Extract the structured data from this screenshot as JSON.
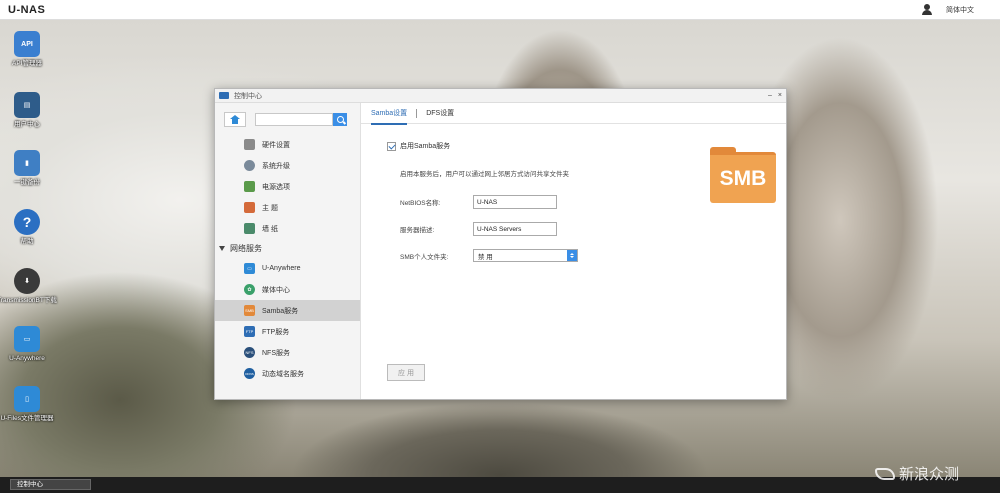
{
  "topbar": {
    "brand": "U-NAS",
    "language": "简体中文"
  },
  "desktop": {
    "icons": [
      {
        "label": "API管理器",
        "color": "#3a7fd0",
        "glyph": "API"
      },
      {
        "label": "用户中心",
        "color": "#2e5c8a",
        "glyph": "▤"
      },
      {
        "label": "一键备份",
        "color": "#3f7fc4",
        "glyph": "▮"
      },
      {
        "label": "帮助",
        "color": "#2b6fc2",
        "glyph": "?"
      },
      {
        "label": "TransmissionBT下载",
        "color": "#3a3a3a",
        "glyph": "⬇"
      },
      {
        "label": "U-Anywhere",
        "color": "#2e8ad6",
        "glyph": "▭"
      },
      {
        "label": "U-Files文件管理器",
        "color": "#2e8ad6",
        "glyph": "▯"
      }
    ]
  },
  "window": {
    "title": "控制中心",
    "controls": {
      "min": "–",
      "close": "×"
    },
    "search": {
      "placeholder": ""
    },
    "sidebar": {
      "items_top": [
        {
          "label": "硬件设置",
          "icon": "hardware-icon",
          "color": "#8a8a8a"
        },
        {
          "label": "系统升级",
          "icon": "upgrade-icon",
          "color": "#7a8a9a"
        },
        {
          "label": "电源选项",
          "icon": "power-icon",
          "color": "#5a9a4a"
        },
        {
          "label": "主 题",
          "icon": "theme-icon",
          "color": "#d46a3a"
        },
        {
          "label": "墙 纸",
          "icon": "wallpaper-icon",
          "color": "#4a8a6a"
        }
      ],
      "group": "网络服务",
      "items_network": [
        {
          "label": "U-Anywhere",
          "icon": "u-anywhere-icon",
          "color": "#2e8ad6",
          "glyph": "▭"
        },
        {
          "label": "媒体中心",
          "icon": "media-center-icon",
          "color": "#3aa06a",
          "glyph": "✿"
        },
        {
          "label": "Samba服务",
          "icon": "samba-icon",
          "color": "#e2893a",
          "glyph": "SMB"
        },
        {
          "label": "FTP服务",
          "icon": "ftp-icon",
          "color": "#2e6db4",
          "glyph": "FTP"
        },
        {
          "label": "NFS服务",
          "icon": "nfs-icon",
          "color": "#2a4f7a",
          "glyph": "NFS"
        },
        {
          "label": "动态域名服务",
          "icon": "ddns-icon",
          "color": "#1f5fa0",
          "glyph": "DDNS"
        }
      ],
      "active": "Samba服务"
    },
    "tabs": [
      "Samba设置",
      "DFS设置"
    ],
    "active_tab": "Samba设置",
    "form": {
      "enable_label": "启用Samba服务",
      "enable_checked": true,
      "description": "启用本服务后，用户可以通过网上邻居方式访问共享文件夹",
      "netbios_label": "NetBIOS名称:",
      "netbios_value": "U-NAS",
      "server_desc_label": "服务器描述:",
      "server_desc_value": "U-NAS Servers",
      "personal_folder_label": "SMB个人文件夹:",
      "personal_folder_value": "禁 用",
      "apply_label": "应 用"
    },
    "badge": "SMB"
  },
  "taskbar": {
    "active_app": "控制中心"
  },
  "watermark": "新浪众测"
}
